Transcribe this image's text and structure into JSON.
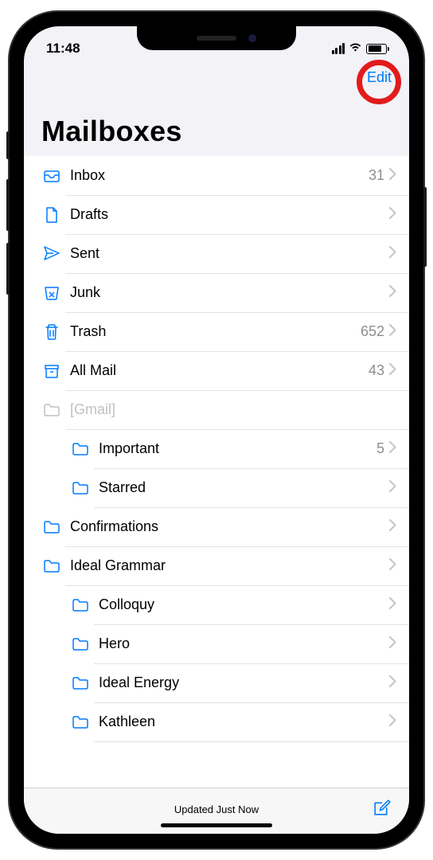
{
  "status": {
    "time": "11:48"
  },
  "nav": {
    "edit": "Edit"
  },
  "title": "Mailboxes",
  "mailboxes": [
    {
      "icon": "inbox",
      "label": "Inbox",
      "count": "31",
      "indent": 1,
      "interactable": true
    },
    {
      "icon": "draft",
      "label": "Drafts",
      "count": "",
      "indent": 1,
      "interactable": true
    },
    {
      "icon": "sent",
      "label": "Sent",
      "count": "",
      "indent": 1,
      "interactable": true
    },
    {
      "icon": "junk",
      "label": "Junk",
      "count": "",
      "indent": 1,
      "interactable": true
    },
    {
      "icon": "trash",
      "label": "Trash",
      "count": "652",
      "indent": 1,
      "interactable": true
    },
    {
      "icon": "archive",
      "label": "All Mail",
      "count": "43",
      "indent": 1,
      "interactable": true
    },
    {
      "icon": "folder-gray",
      "label": "[Gmail]",
      "count": "",
      "indent": 1,
      "interactable": false
    },
    {
      "icon": "folder",
      "label": "Important",
      "count": "5",
      "indent": 2,
      "interactable": true
    },
    {
      "icon": "folder",
      "label": "Starred",
      "count": "",
      "indent": 2,
      "interactable": true
    },
    {
      "icon": "folder",
      "label": "Confirmations",
      "count": "",
      "indent": 1,
      "interactable": true
    },
    {
      "icon": "folder",
      "label": "Ideal Grammar",
      "count": "",
      "indent": 1,
      "interactable": true
    },
    {
      "icon": "folder",
      "label": "Colloquy",
      "count": "",
      "indent": 2,
      "interactable": true
    },
    {
      "icon": "folder",
      "label": "Hero",
      "count": "",
      "indent": 2,
      "interactable": true
    },
    {
      "icon": "folder",
      "label": "Ideal Energy",
      "count": "",
      "indent": 2,
      "interactable": true
    },
    {
      "icon": "folder",
      "label": "Kathleen",
      "count": "",
      "indent": 2,
      "interactable": true
    }
  ],
  "toolbar": {
    "status": "Updated Just Now"
  }
}
